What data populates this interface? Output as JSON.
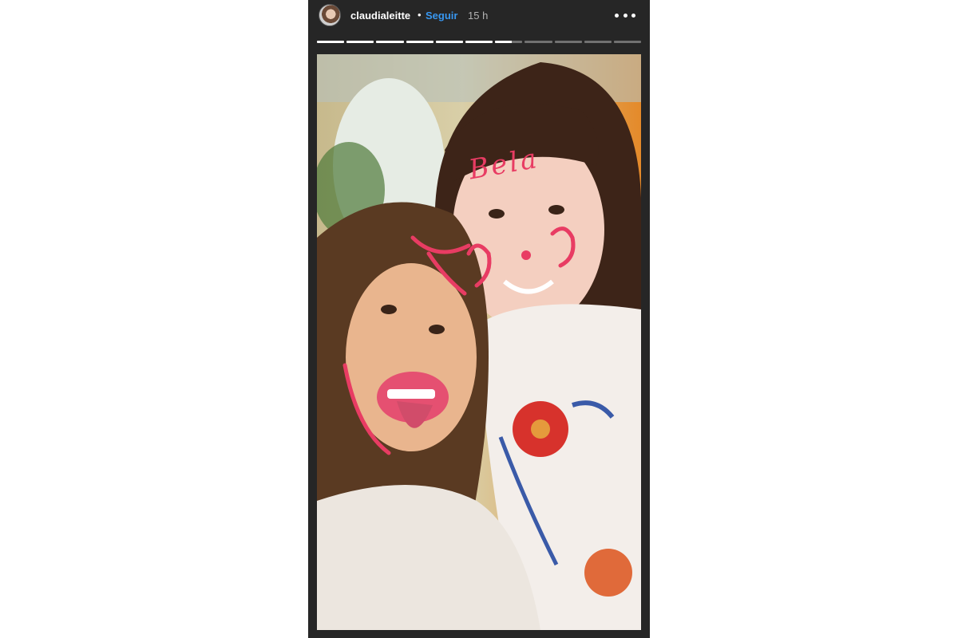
{
  "story": {
    "username": "claudialeitte",
    "separator": "•",
    "follow_label": "Seguir",
    "time_ago": "15 h",
    "segments": [
      1,
      1,
      1,
      1,
      1,
      1,
      0.6,
      0,
      0,
      0,
      0
    ],
    "photo_text": "Bela",
    "icons": {
      "avatar": "user-avatar",
      "more": "more-horizontal-icon"
    },
    "colors": {
      "follow": "#3897f0",
      "background": "#262626"
    }
  }
}
